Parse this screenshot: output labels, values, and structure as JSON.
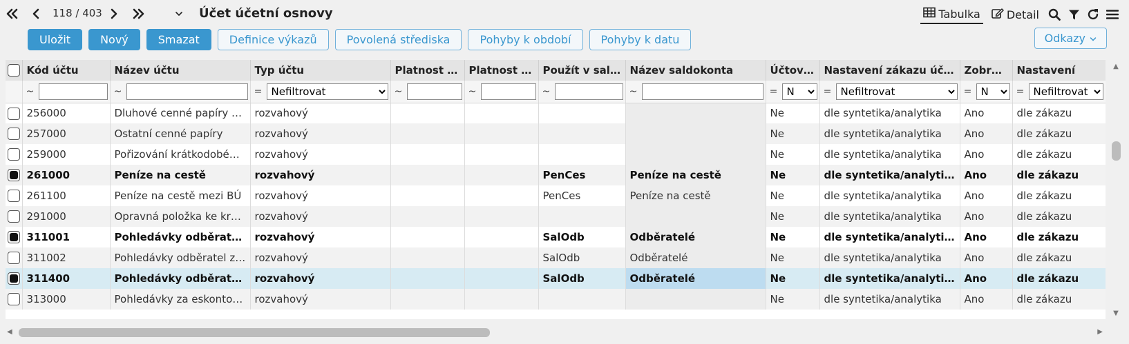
{
  "header": {
    "pager": "118 / 403",
    "title": "Účet účetní osnovy",
    "tabs": [
      {
        "label": "Tabulka",
        "icon": "table-icon"
      },
      {
        "label": "Detail",
        "icon": "edit-icon"
      }
    ]
  },
  "toolbar": {
    "save": "Uložit",
    "new": "Nový",
    "delete": "Smazat",
    "report_def": "Definice výkazů",
    "allowed_centers": "Povolená střediska",
    "movements_period": "Pohyby k období",
    "movements_date": "Pohyby k datu",
    "links": "Odkazy"
  },
  "columns": [
    {
      "label": "Kód účtu",
      "filter_op": "~",
      "filter_type": "text",
      "filter_value": ""
    },
    {
      "label": "Název účtu",
      "filter_op": "~",
      "filter_type": "text",
      "filter_value": ""
    },
    {
      "label": "Typ účtu",
      "filter_op": "=",
      "filter_type": "select",
      "filter_value": "Nefiltrovat"
    },
    {
      "label": "Platnost od",
      "filter_op": "~",
      "filter_type": "text",
      "filter_value": ""
    },
    {
      "label": "Platnost do",
      "filter_op": "~",
      "filter_type": "text",
      "filter_value": ""
    },
    {
      "label": "Použít v saldokontě",
      "filter_op": "~",
      "filter_type": "text",
      "filter_value": ""
    },
    {
      "label": "Název saldokonta",
      "filter_op": "~",
      "filter_type": "text",
      "filter_value": ""
    },
    {
      "label": "Účtování z",
      "filter_op": "=",
      "filter_type": "select",
      "filter_value": "N"
    },
    {
      "label": "Nastavení zákazu účtování",
      "filter_op": "=",
      "filter_type": "select",
      "filter_value": "Nefiltrovat"
    },
    {
      "label": "Zobrazit v",
      "filter_op": "=",
      "filter_type": "select",
      "filter_value": "N"
    },
    {
      "label": "Nastavení",
      "filter_op": "=",
      "filter_type": "select",
      "filter_value": "Nefiltrovat"
    }
  ],
  "rows": [
    {
      "checked": false,
      "bold": false,
      "selected": false,
      "cells": [
        "256000",
        "Dluhové cenné papíry se splatností do jednoho roku",
        "rozvahový",
        "",
        "",
        "",
        "",
        "Ne",
        "dle syntetika/analytika",
        "Ano",
        "dle zákazu"
      ]
    },
    {
      "checked": false,
      "bold": false,
      "selected": false,
      "cells": [
        "257000",
        "Ostatní cenné papíry",
        "rozvahový",
        "",
        "",
        "",
        "",
        "Ne",
        "dle syntetika/analytika",
        "Ano",
        "dle zákazu"
      ]
    },
    {
      "checked": false,
      "bold": false,
      "selected": false,
      "cells": [
        "259000",
        "Pořizování krátkodobého finančního majetku",
        "rozvahový",
        "",
        "",
        "",
        "",
        "Ne",
        "dle syntetika/analytika",
        "Ano",
        "dle zákazu"
      ]
    },
    {
      "checked": true,
      "bold": true,
      "selected": false,
      "cells": [
        "261000",
        "Peníze na cestě",
        "rozvahový",
        "",
        "",
        "PenCes",
        "Peníze na cestě",
        "Ne",
        "dle syntetika/analytika",
        "Ano",
        "dle zákazu"
      ]
    },
    {
      "checked": false,
      "bold": false,
      "selected": false,
      "cells": [
        "261100",
        "Peníze na cestě mezi BÚ",
        "rozvahový",
        "",
        "",
        "PenCes",
        "Peníze na cestě",
        "Ne",
        "dle syntetika/analytika",
        "Ano",
        "dle zákazu"
      ]
    },
    {
      "checked": false,
      "bold": false,
      "selected": false,
      "cells": [
        "291000",
        "Opravná položka ke krátkodobému finančnímu majetku",
        "rozvahový",
        "",
        "",
        "",
        "",
        "Ne",
        "dle syntetika/analytika",
        "Ano",
        "dle zákazu"
      ]
    },
    {
      "checked": true,
      "bold": true,
      "selected": false,
      "cells": [
        "311001",
        "Pohledávky odběratelé tuzemsko",
        "rozvahový",
        "",
        "",
        "SalOdb",
        "Odběratelé",
        "Ne",
        "dle syntetika/analytika",
        "Ano",
        "dle zákazu"
      ]
    },
    {
      "checked": false,
      "bold": false,
      "selected": false,
      "cells": [
        "311002",
        "Pohledávky odběratel zahraničí",
        "rozvahový",
        "",
        "",
        "SalOdb",
        "Odběratelé",
        "Ne",
        "dle syntetika/analytika",
        "Ano",
        "dle zákazu"
      ]
    },
    {
      "checked": true,
      "bold": true,
      "selected": true,
      "cells": [
        "311400",
        "Pohledávky odběratelé-personál",
        "rozvahový",
        "",
        "",
        "SalOdb",
        "Odběratelé",
        "Ne",
        "dle syntetika/analytika",
        "Ano",
        "dle zákazu"
      ]
    },
    {
      "checked": false,
      "bold": false,
      "selected": false,
      "cells": [
        "313000",
        "Pohledávky za eskontované cenné papíry",
        "rozvahový",
        "",
        "",
        "",
        "",
        "Ne",
        "dle syntetika/analytika",
        "Ano",
        "dle zákazu"
      ]
    }
  ]
}
